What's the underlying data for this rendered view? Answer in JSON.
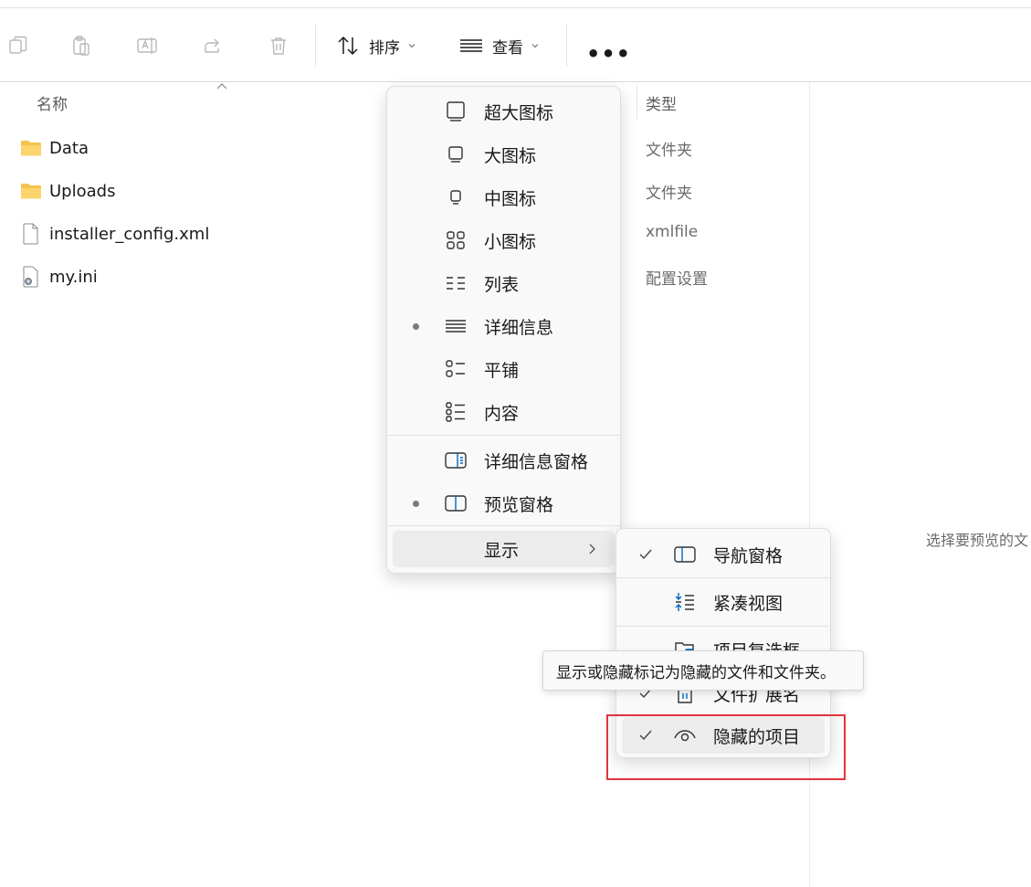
{
  "toolbar": {
    "icons": [
      "copy-icon",
      "paste-icon",
      "rename-icon",
      "share-icon",
      "delete-icon"
    ],
    "sort_label": "排序",
    "view_label": "查看",
    "more_label": "•••"
  },
  "columns": {
    "name": "名称",
    "type": "类型"
  },
  "files": [
    {
      "name": "Data",
      "type": "文件夹",
      "icon": "folder-icon"
    },
    {
      "name": "Uploads",
      "type": "文件夹",
      "icon": "folder-icon"
    },
    {
      "name": "installer_config.xml",
      "type": "xmlfile",
      "icon": "file-icon"
    },
    {
      "name": "my.ini",
      "type": "配置设置",
      "icon": "config-file-icon"
    }
  ],
  "preview_pane": {
    "text": "选择要预览的文"
  },
  "view_menu": {
    "items": [
      {
        "label": "超大图标",
        "icon": "extra-large-icons-icon",
        "selected": false
      },
      {
        "label": "大图标",
        "icon": "large-icons-icon",
        "selected": false
      },
      {
        "label": "中图标",
        "icon": "medium-icons-icon",
        "selected": false
      },
      {
        "label": "小图标",
        "icon": "small-icons-icon",
        "selected": false
      },
      {
        "label": "列表",
        "icon": "list-icon",
        "selected": false
      },
      {
        "label": "详细信息",
        "icon": "details-icon",
        "selected": true
      },
      {
        "label": "平铺",
        "icon": "tiles-icon",
        "selected": false
      },
      {
        "label": "内容",
        "icon": "content-icon",
        "selected": false
      }
    ],
    "panes": [
      {
        "label": "详细信息窗格",
        "icon": "details-pane-icon",
        "selected": false
      },
      {
        "label": "预览窗格",
        "icon": "preview-pane-icon",
        "selected": true
      }
    ],
    "show_label": "显示"
  },
  "show_submenu": {
    "items": [
      {
        "label": "导航窗格",
        "icon": "navigation-pane-icon",
        "checked": true
      },
      {
        "label": "紧凑视图",
        "icon": "compact-view-icon",
        "checked": false
      },
      {
        "label": "项目复选框",
        "icon": "item-checkbox-icon",
        "checked": false
      },
      {
        "label": "文件扩展名",
        "icon": "file-extension-icon",
        "checked": true
      },
      {
        "label": "隐藏的项目",
        "icon": "eye-icon",
        "checked": true
      }
    ]
  },
  "tooltip": {
    "text": "显示或隐藏标记为隐藏的文件和文件夹。"
  },
  "colors": {
    "accent": "#0067c0",
    "highlight_box": "#e0343a",
    "menu_bg": "#f9f9f9"
  }
}
